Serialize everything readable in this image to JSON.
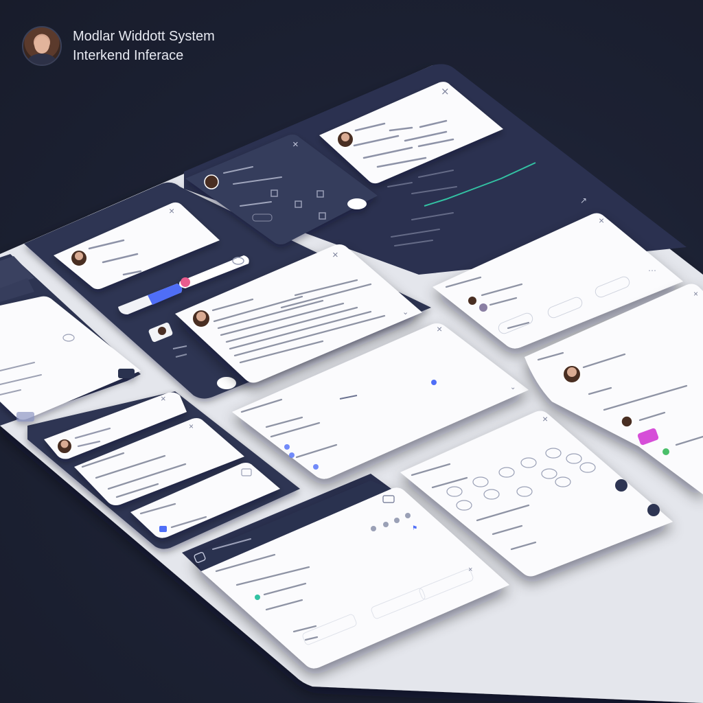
{
  "brand": {
    "title_line1": "Modlar Widdott System",
    "title_line2": "Interkend Inferace",
    "avatar_icon": "person-avatar-icon"
  },
  "colors": {
    "background": "#1c2133",
    "dark_panel": "#2c3350",
    "light_panel": "#fbfbfd",
    "accent_blue": "#4f6ef7",
    "accent_pink": "#e95c8e",
    "accent_magenta": "#d64fd8",
    "accent_teal": "#33c2a3",
    "accent_green": "#4bbf6b"
  },
  "widgets": {
    "modal_top": {
      "close_icon": "close-icon"
    },
    "modal_main": {
      "close_icon": "close-icon"
    },
    "modal_right": {
      "close_icon": "close-icon"
    },
    "modal_bottom_right": {
      "close_icon": "close-icon"
    },
    "toggle": {
      "left_color": "#4f6ef7",
      "right_color": "#e95c8e"
    }
  }
}
